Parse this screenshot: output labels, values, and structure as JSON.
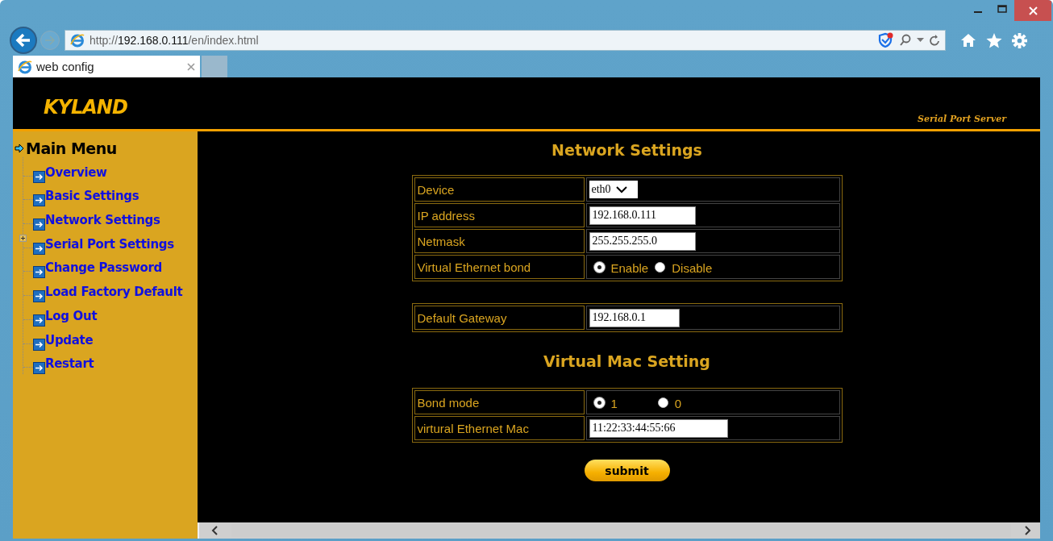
{
  "browser": {
    "url": "http://**192.168.0.111**/en/index.html",
    "tabs": [
      {
        "title": "web config",
        "selected": true
      }
    ]
  },
  "header": {
    "logo": "KYLAND",
    "subtitle": "Serial Port Server"
  },
  "sidebar": {
    "title": "Main Menu",
    "items": [
      {
        "label": "Overview",
        "collapsed": false
      },
      {
        "label": "Basic Settings",
        "collapsed": false
      },
      {
        "label": "Network Settings",
        "collapsed": false
      },
      {
        "label": "Serial Port Settings",
        "collapsed": true
      },
      {
        "label": "Change Password",
        "collapsed": false
      },
      {
        "label": "Load Factory Default",
        "collapsed": false
      },
      {
        "label": "Log Out",
        "collapsed": false
      },
      {
        "label": "Update",
        "collapsed": false
      },
      {
        "label": "Restart",
        "collapsed": false
      }
    ]
  },
  "sections": [
    {
      "title": "Network Settings",
      "tables": [
        [
          {
            "label": "Device",
            "kind": "select",
            "value": "eth0"
          },
          {
            "label": "IP address",
            "kind": "input",
            "value": "192.168.0.111"
          },
          {
            "label": "Netmask",
            "kind": "input",
            "value": "255.255.255.0"
          },
          {
            "label": "Virtual Ethernet bond",
            "kind": "radio",
            "options": [
              {
                "label": "Enable",
                "selected": true
              },
              {
                "label": "Disable",
                "selected": false
              }
            ]
          }
        ],
        [
          {
            "label": "Default Gateway",
            "kind": "input",
            "value": "192.168.0.1"
          }
        ]
      ]
    },
    {
      "title": "Virtual Mac Setting",
      "tables": [
        [
          {
            "label": "Bond mode",
            "kind": "radio",
            "options": [
              {
                "label": "1",
                "selected": true
              },
              {
                "label": "0",
                "selected": false
              }
            ]
          },
          {
            "label": "virtural Ethernet Mac",
            "kind": "input",
            "value": "11:22:33:44:55:66"
          }
        ]
      ]
    }
  ],
  "submit": "submit"
}
